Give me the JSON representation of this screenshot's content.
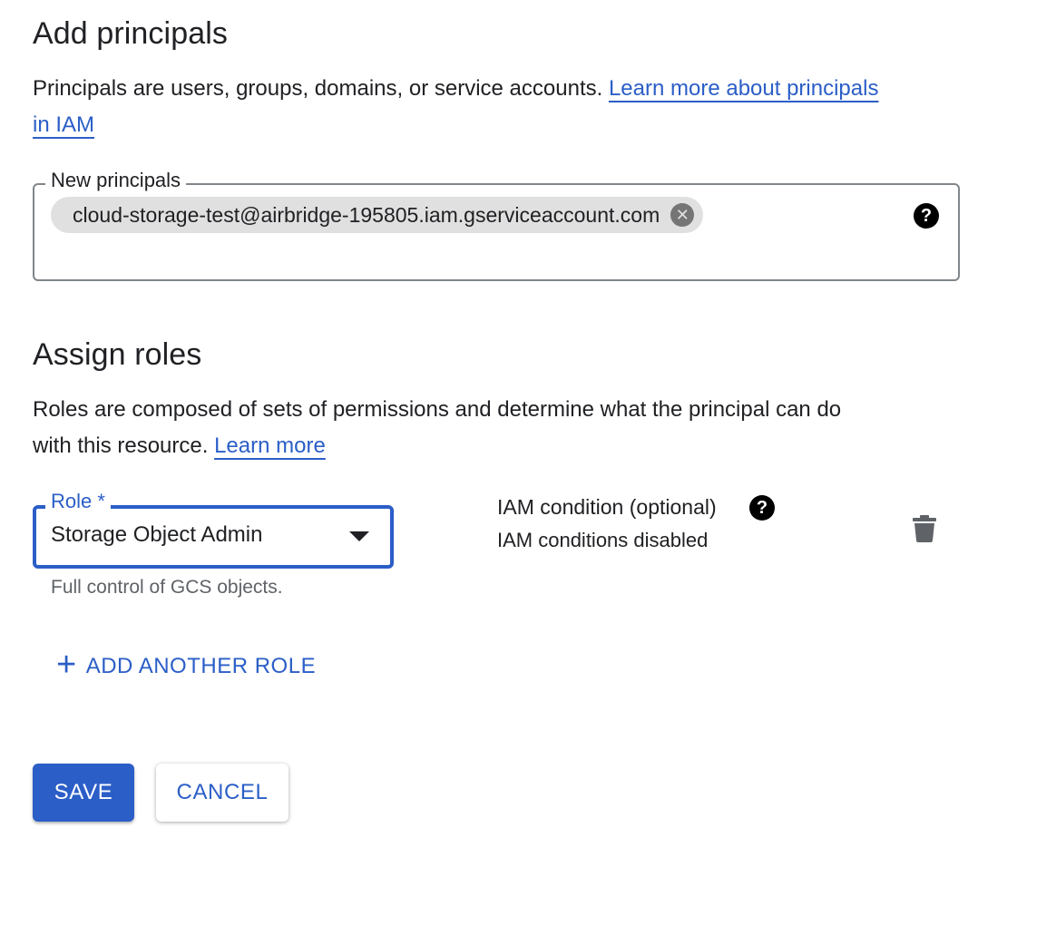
{
  "principals_section": {
    "title": "Add principals",
    "description": "Principals are users, groups, domains, or service accounts.",
    "learn_more_line1": "Learn more about principals",
    "learn_more_line2": "in IAM",
    "field_label": "New principals",
    "chip_value": "cloud-storage-test@airbridge-195805.iam.gserviceaccount.com",
    "chip_remove_icon": "x-circle-icon",
    "help_icon": "help-circle-icon"
  },
  "roles_section": {
    "title": "Assign roles",
    "description_line1": "Roles are composed of sets of permissions and determine what the principal can do",
    "description_line2": "with this resource.",
    "learn_more": "Learn more",
    "role_label": "Role *",
    "role_value": "Storage Object Admin",
    "role_helper": "Full control of GCS objects.",
    "condition_title": "IAM condition (optional)",
    "condition_status": "IAM conditions disabled",
    "delete_icon": "trash-icon",
    "add_role_label": "ADD ANOTHER ROLE"
  },
  "actions": {
    "save_label": "SAVE",
    "cancel_label": "CANCEL"
  },
  "colors": {
    "accent": "#2b5ec7",
    "chip_bg": "#e0e0e0",
    "border": "#80868b"
  }
}
